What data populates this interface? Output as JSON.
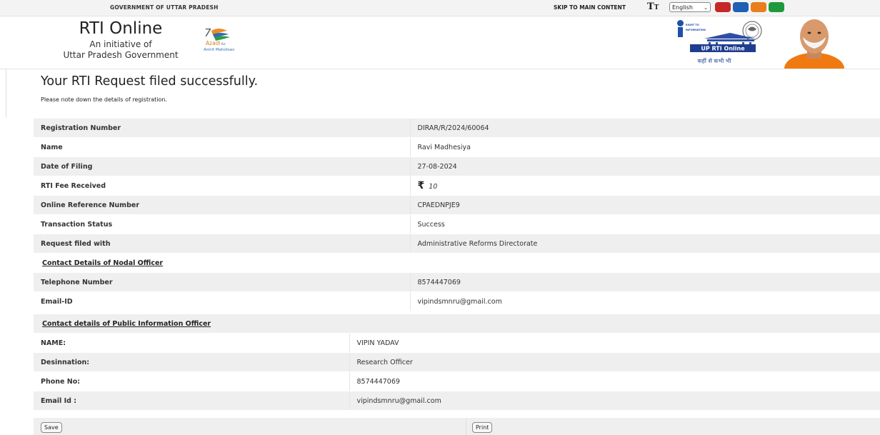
{
  "topbar": {
    "gov_label": "GOVERNMENT OF UTTAR PRADESH",
    "skip_label": "SKIP TO MAIN CONTENT",
    "text_size_label_big": "T",
    "text_size_label_small": "T",
    "language": "English",
    "theme_colors": [
      "#c62828",
      "#1f5fb4",
      "#e87f1c",
      "#1e9a3c"
    ]
  },
  "header": {
    "title": "RTI Online",
    "subtitle1": "An initiative of",
    "subtitle2": "Uttar Pradesh Government",
    "azadi_text": "Azadi",
    "azadi_ka": "Ka",
    "amrit_mahotsav": "Amrit Mahotsav",
    "rti_small1": "RIGHT TO",
    "rti_small2": "INFORMATION",
    "up_rti_online": "UP RTI Online",
    "tagline": "कहीं से कभी भी"
  },
  "main": {
    "heading": "Your RTI Request filed successfully.",
    "note": "Please note down the details of registration."
  },
  "registration": {
    "rows": [
      {
        "label": "Registration Number",
        "value": "DIRAR/R/2024/60064"
      },
      {
        "label": "Name",
        "value": "Ravi Madhesiya"
      },
      {
        "label": "Date of Filing",
        "value": "27-08-2024"
      },
      {
        "label": "RTI Fee Received",
        "value": "10",
        "currency": "₹"
      },
      {
        "label": "Online Reference Number",
        "value": "CPAEDNPJE9"
      },
      {
        "label": "Transaction Status",
        "value": "Success"
      },
      {
        "label": "Request filed with",
        "value": "Administrative Reforms Directorate"
      }
    ],
    "nodal_heading": "Contact Details of Nodal Officer",
    "nodal_rows": [
      {
        "label": "Telephone Number",
        "value": "8574447069"
      },
      {
        "label": "Email-ID",
        "value": "vipindsmnru@gmail.com"
      }
    ]
  },
  "pio": {
    "heading": "Contact details of Public Information Officer",
    "rows": [
      {
        "label": "NAME:",
        "value": "VIPIN YADAV"
      },
      {
        "label": "Desinnation:",
        "value": "Research Officer"
      },
      {
        "label": "Phone No:",
        "value": "8574447069"
      },
      {
        "label": "Email Id :",
        "value": "vipindsmnru@gmail.com"
      }
    ]
  },
  "buttons": {
    "save": "Save",
    "print": "Print"
  }
}
